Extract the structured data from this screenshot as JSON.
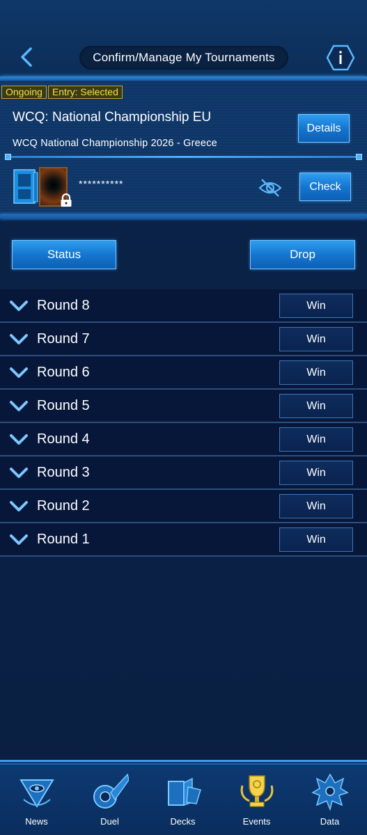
{
  "header": {
    "title": "Confirm/Manage My Tournaments",
    "back_icon": "chevron-left-icon",
    "info_icon": "info-icon"
  },
  "tournament": {
    "badges": [
      "Ongoing",
      "Entry: Selected"
    ],
    "name": "WCQ: National Championship EU",
    "subtitle": "WCQ National Championship 2026 - Greece",
    "details_label": "Details",
    "deck_password": "**********",
    "check_label": "Check"
  },
  "actions": {
    "status_label": "Status",
    "drop_label": "Drop"
  },
  "rounds": [
    {
      "label": "Round 8",
      "result": "Win"
    },
    {
      "label": "Round 7",
      "result": "Win"
    },
    {
      "label": "Round 6",
      "result": "Win"
    },
    {
      "label": "Round 5",
      "result": "Win"
    },
    {
      "label": "Round 4",
      "result": "Win"
    },
    {
      "label": "Round 3",
      "result": "Win"
    },
    {
      "label": "Round 2",
      "result": "Win"
    },
    {
      "label": "Round 1",
      "result": "Win"
    }
  ],
  "nav": {
    "items": [
      {
        "label": "News",
        "icon": "millennium-eye-icon"
      },
      {
        "label": "Duel",
        "icon": "duel-disk-icon"
      },
      {
        "label": "Decks",
        "icon": "cards-icon"
      },
      {
        "label": "Events",
        "icon": "trophy-icon"
      },
      {
        "label": "Data",
        "icon": "monster-icon"
      }
    ],
    "active": "Events"
  },
  "colors": {
    "accent": "#2f9ef0",
    "badge_text": "#f5e23a",
    "background": "#0a1f42"
  }
}
